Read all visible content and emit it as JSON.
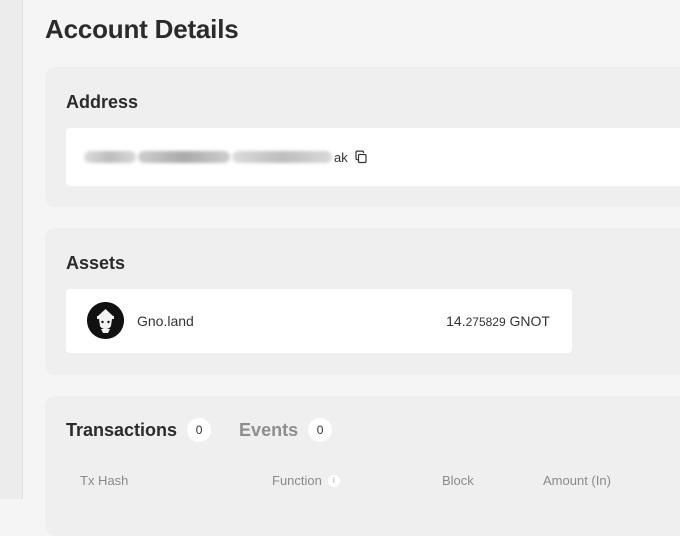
{
  "page": {
    "title": "Account Details"
  },
  "address": {
    "title": "Address",
    "value_visible_suffix": "ak",
    "copy_icon": "copy-icon"
  },
  "assets": {
    "title": "Assets",
    "items": [
      {
        "name": "Gno.land",
        "amount_int": "14.",
        "amount_dec": "275829",
        "denom": "GNOT",
        "icon": "gno-logo"
      }
    ]
  },
  "transactions": {
    "tabs": [
      {
        "label": "Transactions",
        "count": "0",
        "active": true
      },
      {
        "label": "Events",
        "count": "0",
        "active": false
      }
    ],
    "columns": {
      "hash": "Tx Hash",
      "function": "Function",
      "block": "Block",
      "amount": "Amount (In)"
    },
    "info_icon": "info-icon"
  }
}
